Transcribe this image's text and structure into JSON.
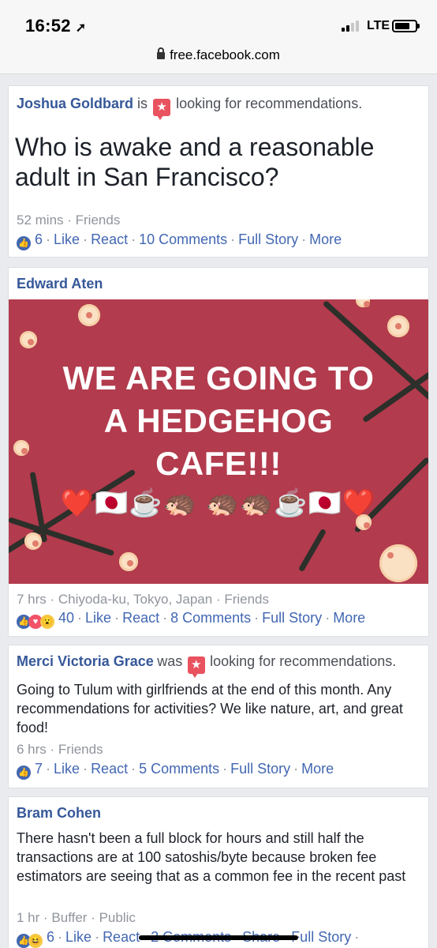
{
  "status_bar": {
    "time": "16:52",
    "network": "LTE",
    "url": "free.facebook.com"
  },
  "posts": [
    {
      "author": "Joshua Goldbard",
      "status_prefix": "is",
      "status_action": "looking for recommendations.",
      "text": "Who is awake and a reasonable adult in San Francisco?",
      "time": "52 mins",
      "audience": "Friends",
      "reaction_count": "6",
      "like": "Like",
      "react": "React",
      "comments": "10 Comments",
      "full_story": "Full Story",
      "more": "More"
    },
    {
      "author": "Edward Aten",
      "image_text_lines": [
        "WE ARE GOING TO",
        "A HEDGEHOG",
        "CAFE!!!"
      ],
      "image_emoji": "❤️🇯🇵☕🦔 🦔🦔☕🇯🇵❤️",
      "time": "7 hrs",
      "location": "Chiyoda-ku, Tokyo, Japan",
      "audience": "Friends",
      "reaction_count": "40",
      "like": "Like",
      "react": "React",
      "comments": "8 Comments",
      "full_story": "Full Story",
      "more": "More"
    },
    {
      "author": "Merci Victoria Grace",
      "status_prefix": "was",
      "status_action": "looking for recommendations.",
      "text": "Going to Tulum with girlfriends at the end of this month. Any recommendations for activities? We like nature, art, and great food!",
      "time": "6 hrs",
      "audience": "Friends",
      "reaction_count": "7",
      "like": "Like",
      "react": "React",
      "comments": "5 Comments",
      "full_story": "Full Story",
      "more": "More"
    },
    {
      "author": "Bram Cohen",
      "text": "There hasn't been a full block for hours and still half the transactions are at 100 satoshis/byte because broken fee estimators are seeing that as a common fee in the recent past",
      "time": "1 hr",
      "via": "Buffer",
      "audience": "Public",
      "reaction_count": "6",
      "like": "Like",
      "react": "React",
      "comments": "2 Comments",
      "share": "Share",
      "full_story": "Full Story"
    }
  ],
  "icons": {
    "like": "like-icon",
    "love": "love-icon",
    "wow": "wow-icon",
    "haha": "haha-icon",
    "recommendation": "star-badge-icon",
    "lock": "lock-icon",
    "location": "location-arrow-icon"
  },
  "colors": {
    "link": "#4267b2",
    "author": "#365899",
    "image_bg": "#b23b4d",
    "badge": "#e9525f"
  }
}
